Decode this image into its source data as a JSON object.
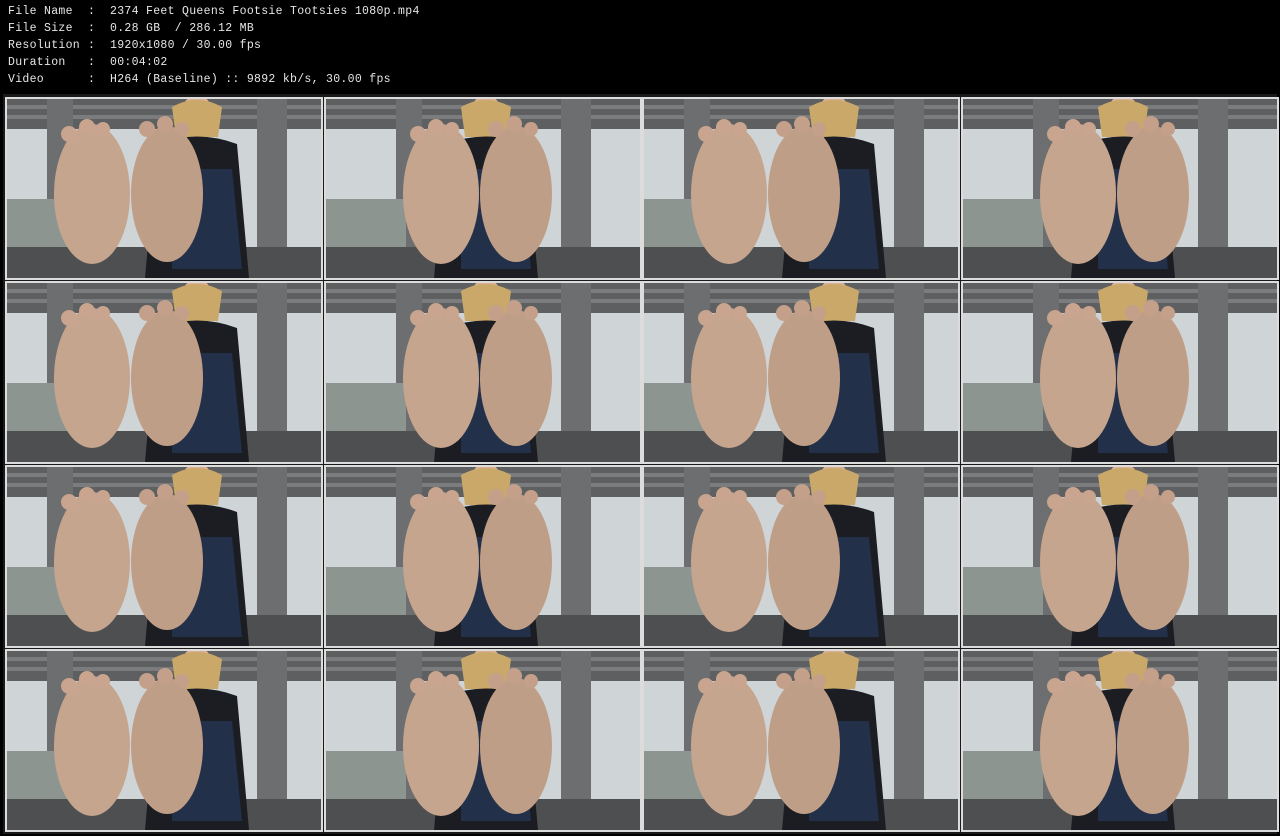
{
  "info": [
    {
      "key": "File Name",
      "value": "2374 Feet Queens Footsie Tootsies 1080p.mp4"
    },
    {
      "key": "File Size",
      "value": "0.28 GB  / 286.12 MB"
    },
    {
      "key": "Resolution",
      "value": "1920x1080 / 30.00 fps"
    },
    {
      "key": "Duration",
      "value": "00:04:02"
    },
    {
      "key": "Video",
      "value": "H264 (Baseline) :: 9892 kb/s, 30.00 fps"
    }
  ],
  "grid": {
    "columns": 4,
    "rows": 4,
    "thumbnail_count": 16
  },
  "colors": {
    "background": "#000000",
    "text": "#e6e6e6",
    "thumb_border": "#dcdcdc"
  }
}
